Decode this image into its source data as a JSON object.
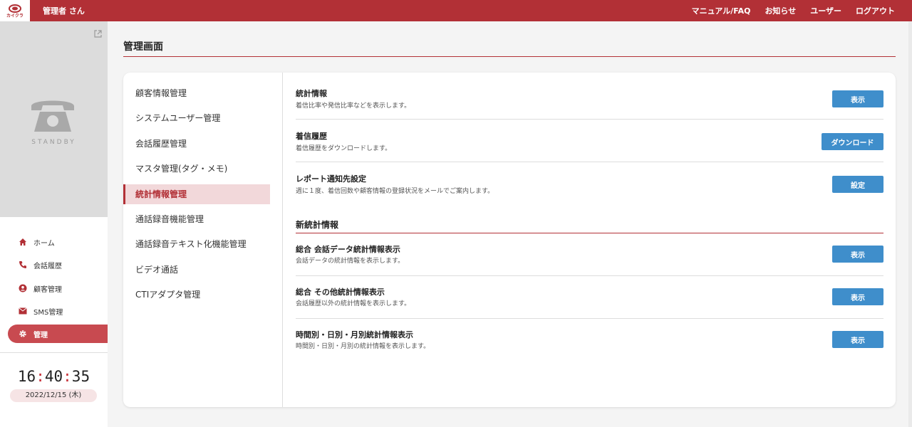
{
  "header": {
    "logo_text": "カイクラ",
    "user_name": "管理者 さん",
    "links": [
      "マニュアル/FAQ",
      "お知らせ",
      "ユーザー",
      "ログアウト"
    ]
  },
  "phone_panel": {
    "status": "STANDBY"
  },
  "nav": {
    "items": [
      {
        "label": "ホーム",
        "icon": "home-icon"
      },
      {
        "label": "会話履歴",
        "icon": "phone-icon"
      },
      {
        "label": "顧客管理",
        "icon": "user-circle-icon"
      },
      {
        "label": "SMS管理",
        "icon": "mail-icon"
      },
      {
        "label": "管理",
        "icon": "gear-icon"
      }
    ],
    "active_index": 4
  },
  "clock": {
    "hh": "16",
    "mm": "40",
    "ss": "35",
    "date": "2022/12/15 (木)"
  },
  "main": {
    "title": "管理画面",
    "menu": [
      "顧客情報管理",
      "システムユーザー管理",
      "会話履歴管理",
      "マスタ管理(タグ・メモ)",
      "統計情報管理",
      "通話録音機能管理",
      "通話録音テキスト化機能管理",
      "ビデオ通話",
      "CTIアダプタ管理"
    ],
    "menu_active_index": 4,
    "rows": [
      {
        "title": "統計情報",
        "desc": "着信比率や発信比率などを表示します。",
        "button": "表示"
      },
      {
        "title": "着信履歴",
        "desc": "着信履歴をダウンロードします。",
        "button": "ダウンロード"
      },
      {
        "title": "レポート通知先設定",
        "desc": "週に１度、着信回数や顧客情報の登録状況をメールでご案内します。",
        "button": "設定"
      }
    ],
    "section_title": "新統計情報",
    "section_rows": [
      {
        "title": "総合 会話データ統計情報表示",
        "desc": "会話データの統計情報を表示します。",
        "button": "表示"
      },
      {
        "title": "総合 その他統計情報表示",
        "desc": "会話履歴以外の統計情報を表示します。",
        "button": "表示"
      },
      {
        "title": "時間別・日別・月別統計情報表示",
        "desc": "時間別・日別・月別の統計情報を表示します。",
        "button": "表示"
      }
    ]
  },
  "colors": {
    "brand": "#b23036",
    "button": "#3f8ecb",
    "active_nav": "#c84a50"
  }
}
